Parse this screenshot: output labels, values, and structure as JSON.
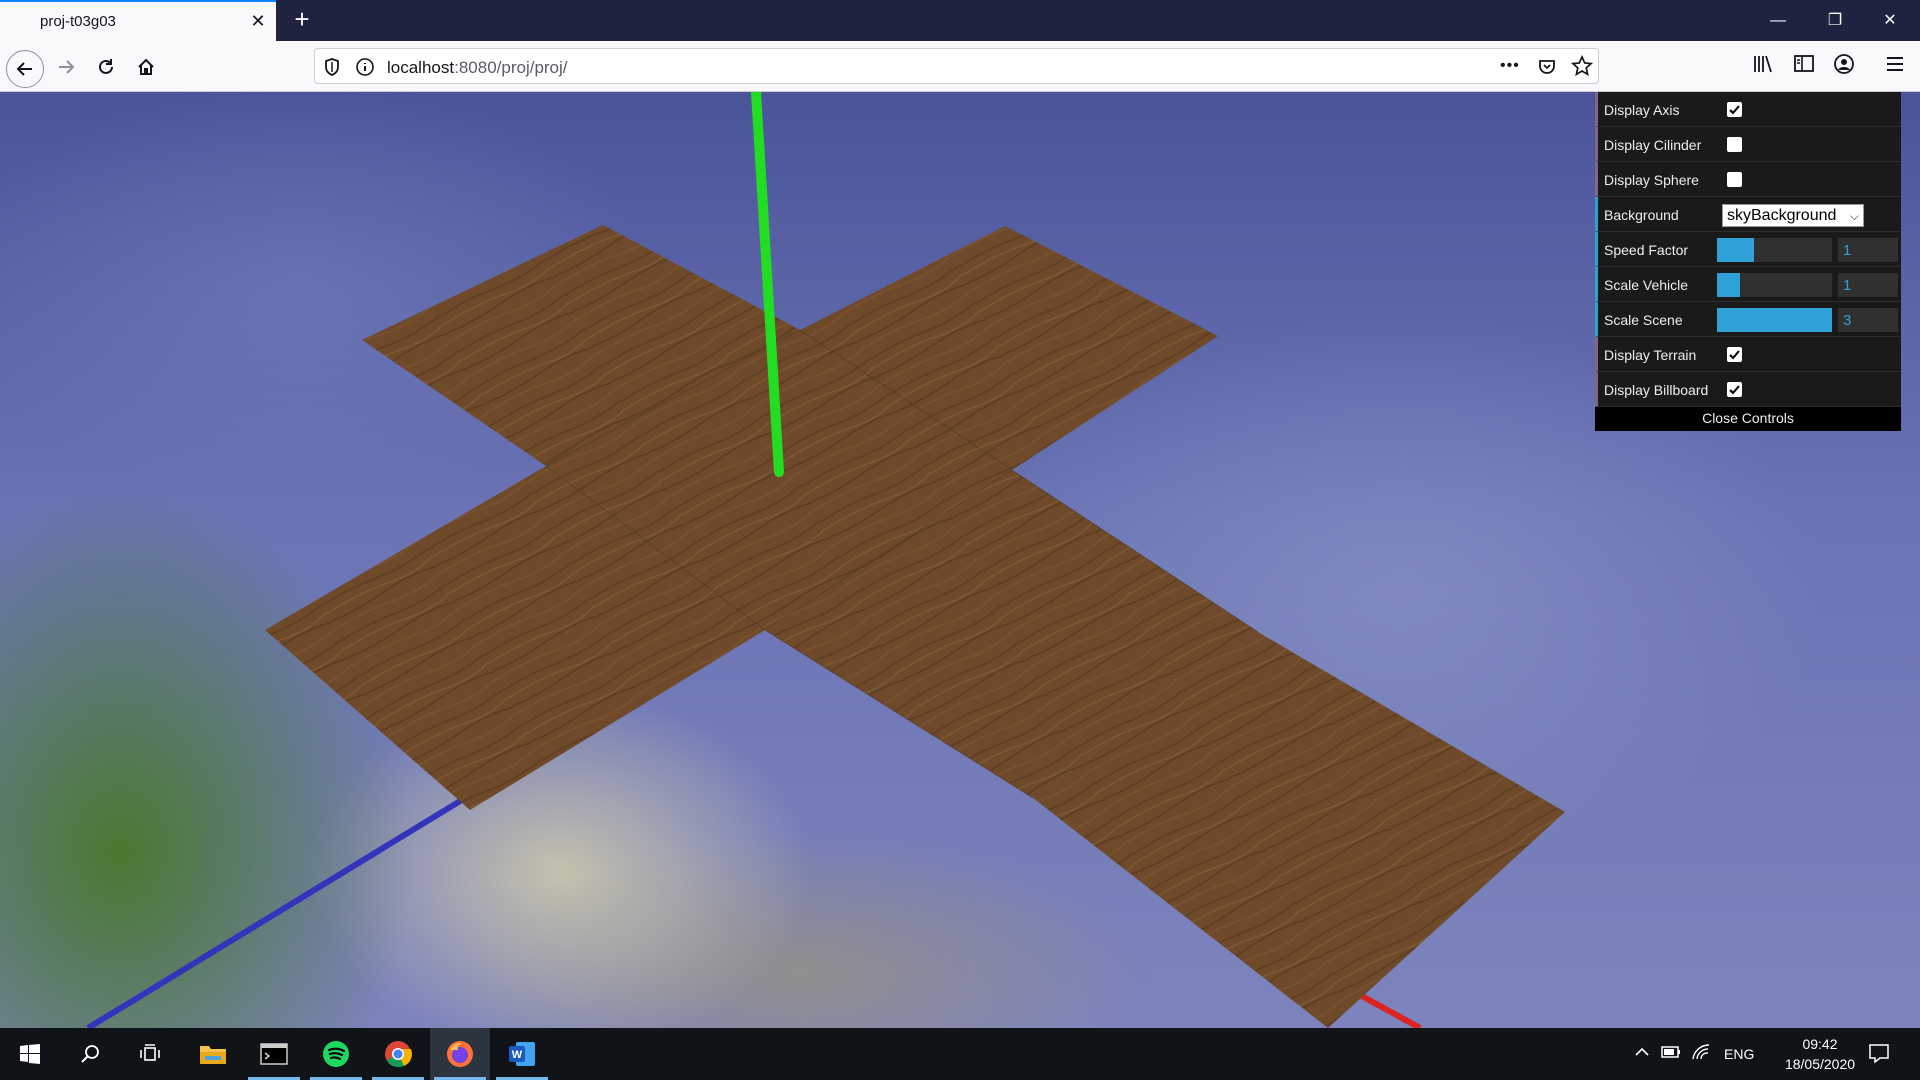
{
  "browser": {
    "tab_title": "proj-t03g03",
    "close_tab_glyph": "✕",
    "new_tab_glyph": "+",
    "url_host": "localhost",
    "url_path": ":8080/proj/proj/",
    "more_glyph": "•••",
    "window_min_glyph": "—",
    "window_restore_glyph": "❐",
    "window_close_glyph": "✕"
  },
  "gui": {
    "display_axis": {
      "label": "Display Axis",
      "checked": true
    },
    "display_cilinder": {
      "label": "Display Cilinder",
      "checked": false
    },
    "display_sphere": {
      "label": "Display Sphere",
      "checked": false
    },
    "background": {
      "label": "Background",
      "value": "skyBackground"
    },
    "speed_factor": {
      "label": "Speed Factor",
      "value": "1",
      "fill_fraction": 0.32
    },
    "scale_vehicle": {
      "label": "Scale Vehicle",
      "value": "1",
      "fill_fraction": 0.2
    },
    "scale_scene": {
      "label": "Scale Scene",
      "value": "3",
      "fill_fraction": 1.0
    },
    "display_terrain": {
      "label": "Display Terrain",
      "checked": true
    },
    "display_billboard": {
      "label": "Display Billboard",
      "checked": true
    },
    "close_label": "Close Controls"
  },
  "taskbar": {
    "language": "ENG",
    "time": "09:42",
    "date": "18/05/2020"
  },
  "colors": {
    "axis_y": "#22dd22",
    "axis_z": "#3333bb",
    "axis_x": "#dd2222",
    "wood": "#6e4a2a",
    "gui_accent": "#2fa1d6"
  },
  "icons": [
    "back-arrow-icon",
    "forward-arrow-icon",
    "reload-icon",
    "home-icon",
    "shield-icon",
    "info-icon",
    "pocket-icon",
    "star-icon",
    "library-icon",
    "sidebar-icon",
    "account-icon",
    "menu-icon",
    "windows-start-icon",
    "search-icon",
    "task-view-icon",
    "file-explorer-icon",
    "terminal-icon",
    "spotify-icon",
    "chrome-icon",
    "firefox-icon",
    "word-icon",
    "chevron-up-icon",
    "battery-icon",
    "wifi-icon",
    "notification-icon"
  ]
}
